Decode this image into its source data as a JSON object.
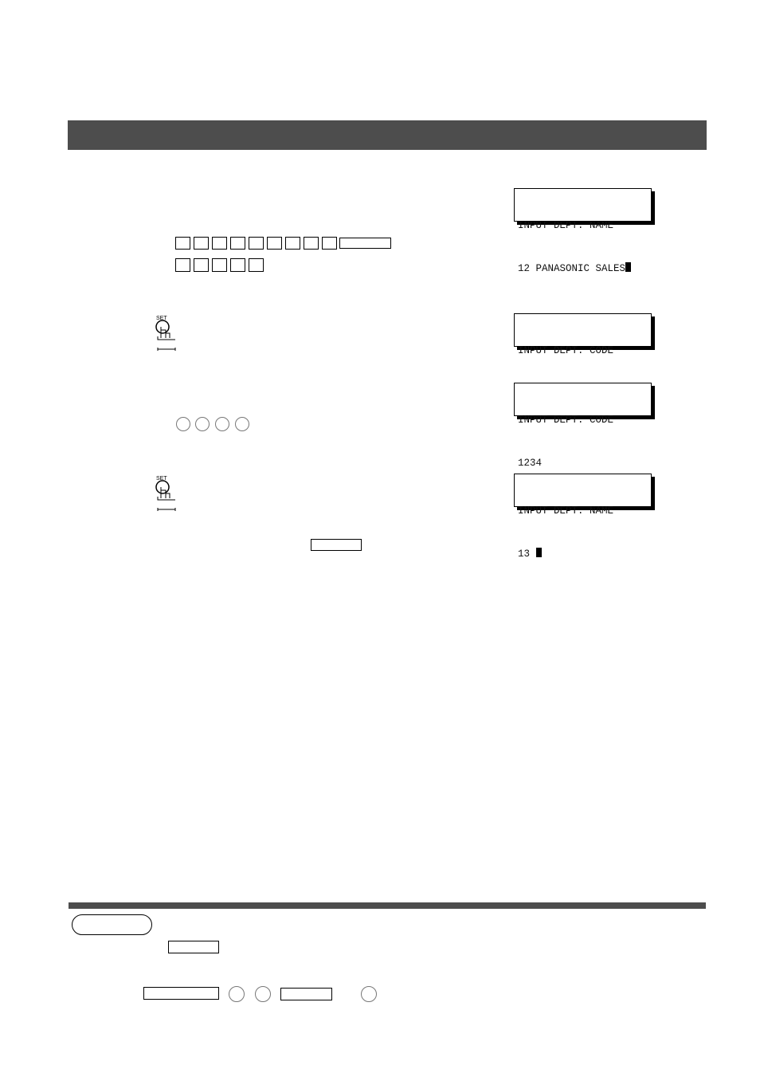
{
  "header_bar_color": "#4d4d4d",
  "displays": [
    {
      "line1": "INPUT DEPT. NAME",
      "line2": "12 PANASONIC SALES",
      "cursor": "block"
    },
    {
      "line1": "INPUT DEPT. CODE",
      "line2": "",
      "cursor": "4 blocks right"
    },
    {
      "line1": "INPUT DEPT. CODE",
      "line2": "1234"
    },
    {
      "line1": "INPUT DEPT. NAME",
      "line2": "13 ",
      "cursor": "block"
    }
  ],
  "set_button": {
    "label": "SET",
    "icon": "finger-press-icon"
  }
}
